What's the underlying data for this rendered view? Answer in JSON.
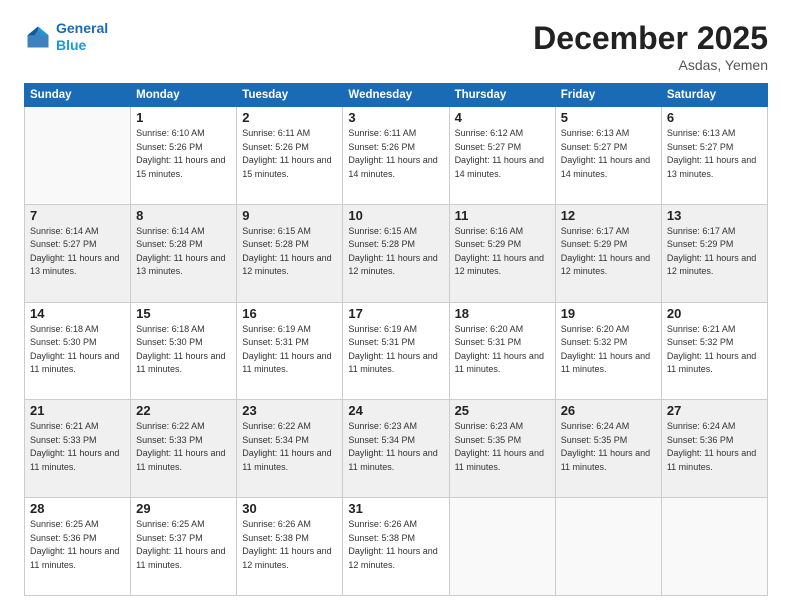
{
  "logo": {
    "line1": "General",
    "line2": "Blue"
  },
  "title": "December 2025",
  "location": "Asdas, Yemen",
  "weekdays": [
    "Sunday",
    "Monday",
    "Tuesday",
    "Wednesday",
    "Thursday",
    "Friday",
    "Saturday"
  ],
  "weeks": [
    [
      {
        "day": "",
        "sunrise": "",
        "sunset": "",
        "daylight": ""
      },
      {
        "day": "1",
        "sunrise": "Sunrise: 6:10 AM",
        "sunset": "Sunset: 5:26 PM",
        "daylight": "Daylight: 11 hours and 15 minutes."
      },
      {
        "day": "2",
        "sunrise": "Sunrise: 6:11 AM",
        "sunset": "Sunset: 5:26 PM",
        "daylight": "Daylight: 11 hours and 15 minutes."
      },
      {
        "day": "3",
        "sunrise": "Sunrise: 6:11 AM",
        "sunset": "Sunset: 5:26 PM",
        "daylight": "Daylight: 11 hours and 14 minutes."
      },
      {
        "day": "4",
        "sunrise": "Sunrise: 6:12 AM",
        "sunset": "Sunset: 5:27 PM",
        "daylight": "Daylight: 11 hours and 14 minutes."
      },
      {
        "day": "5",
        "sunrise": "Sunrise: 6:13 AM",
        "sunset": "Sunset: 5:27 PM",
        "daylight": "Daylight: 11 hours and 14 minutes."
      },
      {
        "day": "6",
        "sunrise": "Sunrise: 6:13 AM",
        "sunset": "Sunset: 5:27 PM",
        "daylight": "Daylight: 11 hours and 13 minutes."
      }
    ],
    [
      {
        "day": "7",
        "sunrise": "Sunrise: 6:14 AM",
        "sunset": "Sunset: 5:27 PM",
        "daylight": "Daylight: 11 hours and 13 minutes."
      },
      {
        "day": "8",
        "sunrise": "Sunrise: 6:14 AM",
        "sunset": "Sunset: 5:28 PM",
        "daylight": "Daylight: 11 hours and 13 minutes."
      },
      {
        "day": "9",
        "sunrise": "Sunrise: 6:15 AM",
        "sunset": "Sunset: 5:28 PM",
        "daylight": "Daylight: 11 hours and 12 minutes."
      },
      {
        "day": "10",
        "sunrise": "Sunrise: 6:15 AM",
        "sunset": "Sunset: 5:28 PM",
        "daylight": "Daylight: 11 hours and 12 minutes."
      },
      {
        "day": "11",
        "sunrise": "Sunrise: 6:16 AM",
        "sunset": "Sunset: 5:29 PM",
        "daylight": "Daylight: 11 hours and 12 minutes."
      },
      {
        "day": "12",
        "sunrise": "Sunrise: 6:17 AM",
        "sunset": "Sunset: 5:29 PM",
        "daylight": "Daylight: 11 hours and 12 minutes."
      },
      {
        "day": "13",
        "sunrise": "Sunrise: 6:17 AM",
        "sunset": "Sunset: 5:29 PM",
        "daylight": "Daylight: 11 hours and 12 minutes."
      }
    ],
    [
      {
        "day": "14",
        "sunrise": "Sunrise: 6:18 AM",
        "sunset": "Sunset: 5:30 PM",
        "daylight": "Daylight: 11 hours and 11 minutes."
      },
      {
        "day": "15",
        "sunrise": "Sunrise: 6:18 AM",
        "sunset": "Sunset: 5:30 PM",
        "daylight": "Daylight: 11 hours and 11 minutes."
      },
      {
        "day": "16",
        "sunrise": "Sunrise: 6:19 AM",
        "sunset": "Sunset: 5:31 PM",
        "daylight": "Daylight: 11 hours and 11 minutes."
      },
      {
        "day": "17",
        "sunrise": "Sunrise: 6:19 AM",
        "sunset": "Sunset: 5:31 PM",
        "daylight": "Daylight: 11 hours and 11 minutes."
      },
      {
        "day": "18",
        "sunrise": "Sunrise: 6:20 AM",
        "sunset": "Sunset: 5:31 PM",
        "daylight": "Daylight: 11 hours and 11 minutes."
      },
      {
        "day": "19",
        "sunrise": "Sunrise: 6:20 AM",
        "sunset": "Sunset: 5:32 PM",
        "daylight": "Daylight: 11 hours and 11 minutes."
      },
      {
        "day": "20",
        "sunrise": "Sunrise: 6:21 AM",
        "sunset": "Sunset: 5:32 PM",
        "daylight": "Daylight: 11 hours and 11 minutes."
      }
    ],
    [
      {
        "day": "21",
        "sunrise": "Sunrise: 6:21 AM",
        "sunset": "Sunset: 5:33 PM",
        "daylight": "Daylight: 11 hours and 11 minutes."
      },
      {
        "day": "22",
        "sunrise": "Sunrise: 6:22 AM",
        "sunset": "Sunset: 5:33 PM",
        "daylight": "Daylight: 11 hours and 11 minutes."
      },
      {
        "day": "23",
        "sunrise": "Sunrise: 6:22 AM",
        "sunset": "Sunset: 5:34 PM",
        "daylight": "Daylight: 11 hours and 11 minutes."
      },
      {
        "day": "24",
        "sunrise": "Sunrise: 6:23 AM",
        "sunset": "Sunset: 5:34 PM",
        "daylight": "Daylight: 11 hours and 11 minutes."
      },
      {
        "day": "25",
        "sunrise": "Sunrise: 6:23 AM",
        "sunset": "Sunset: 5:35 PM",
        "daylight": "Daylight: 11 hours and 11 minutes."
      },
      {
        "day": "26",
        "sunrise": "Sunrise: 6:24 AM",
        "sunset": "Sunset: 5:35 PM",
        "daylight": "Daylight: 11 hours and 11 minutes."
      },
      {
        "day": "27",
        "sunrise": "Sunrise: 6:24 AM",
        "sunset": "Sunset: 5:36 PM",
        "daylight": "Daylight: 11 hours and 11 minutes."
      }
    ],
    [
      {
        "day": "28",
        "sunrise": "Sunrise: 6:25 AM",
        "sunset": "Sunset: 5:36 PM",
        "daylight": "Daylight: 11 hours and 11 minutes."
      },
      {
        "day": "29",
        "sunrise": "Sunrise: 6:25 AM",
        "sunset": "Sunset: 5:37 PM",
        "daylight": "Daylight: 11 hours and 11 minutes."
      },
      {
        "day": "30",
        "sunrise": "Sunrise: 6:26 AM",
        "sunset": "Sunset: 5:38 PM",
        "daylight": "Daylight: 11 hours and 12 minutes."
      },
      {
        "day": "31",
        "sunrise": "Sunrise: 6:26 AM",
        "sunset": "Sunset: 5:38 PM",
        "daylight": "Daylight: 11 hours and 12 minutes."
      },
      {
        "day": "",
        "sunrise": "",
        "sunset": "",
        "daylight": ""
      },
      {
        "day": "",
        "sunrise": "",
        "sunset": "",
        "daylight": ""
      },
      {
        "day": "",
        "sunrise": "",
        "sunset": "",
        "daylight": ""
      }
    ]
  ]
}
